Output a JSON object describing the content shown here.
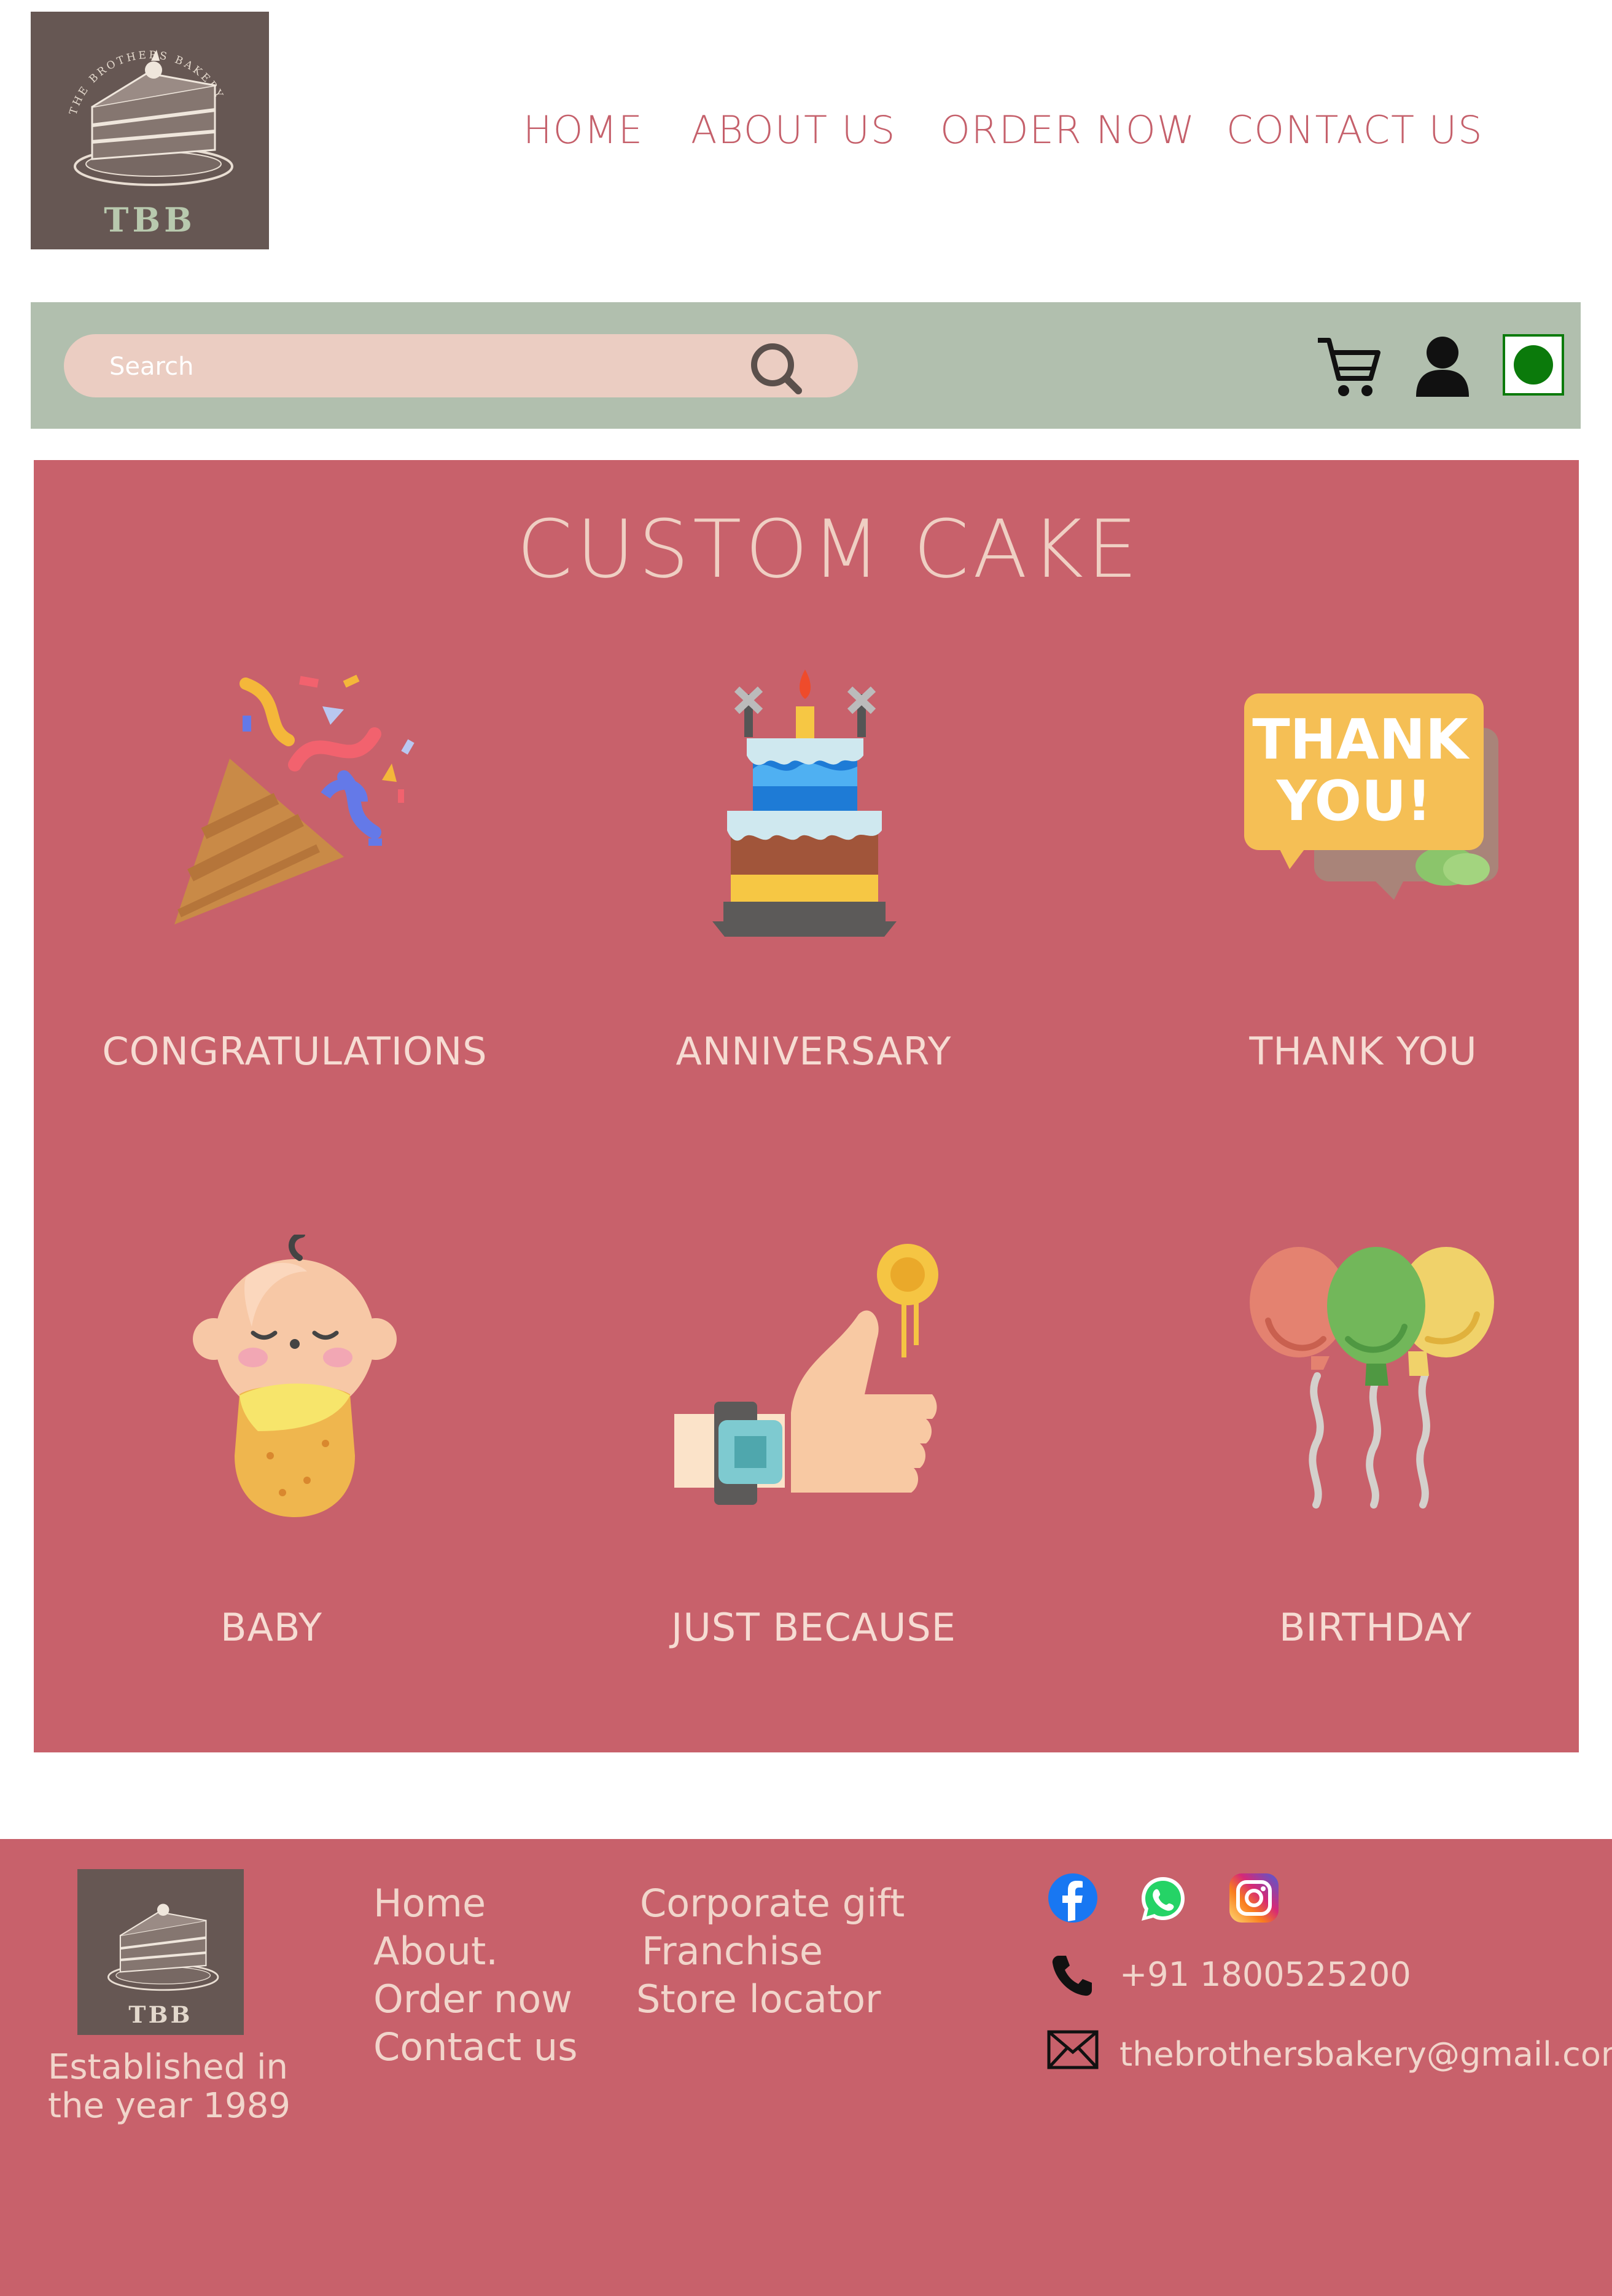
{
  "header": {
    "logo": {
      "monogram": "TBB",
      "ring_text": "THE BROTHERS BAKERY"
    },
    "nav": [
      "HOME",
      "ABOUT US",
      "ORDER NOW",
      "CONTACT US"
    ],
    "nav_color": "#c5606b"
  },
  "toolbar": {
    "search_placeholder": "Search",
    "icons": [
      "search-icon",
      "cart-icon",
      "user-icon",
      "language-flag-icon"
    ],
    "background": "#b1bfae"
  },
  "main": {
    "title": "CUSTOM CAKE",
    "background": "#c8616b",
    "categories": [
      {
        "label": "CONGRATULATIONS",
        "icon": "party-popper-icon"
      },
      {
        "label": "ANNIVERSARY",
        "icon": "cake-icon"
      },
      {
        "label": "THANK YOU",
        "icon": "thank-you-bubble-icon",
        "icon_text": [
          "THANK",
          "YOU!"
        ]
      },
      {
        "label": "BABY",
        "icon": "baby-icon"
      },
      {
        "label": "JUST BECAUSE",
        "icon": "thumbs-up-icon"
      },
      {
        "label": "BIRTHDAY",
        "icon": "balloons-icon"
      }
    ]
  },
  "footer": {
    "logo_monogram": "TBB",
    "established": [
      "Established in",
      "the year 1989"
    ],
    "links_col1": [
      "Home",
      "About.",
      "Order now",
      "Contact us"
    ],
    "links_col2": [
      "Corporate gift",
      "Franchise",
      "Store locator"
    ],
    "social": [
      "facebook-icon",
      "whatsapp-icon",
      "instagram-icon"
    ],
    "phone": "+91 1800525200",
    "email": "thebrothersbakery@gmail.com"
  }
}
